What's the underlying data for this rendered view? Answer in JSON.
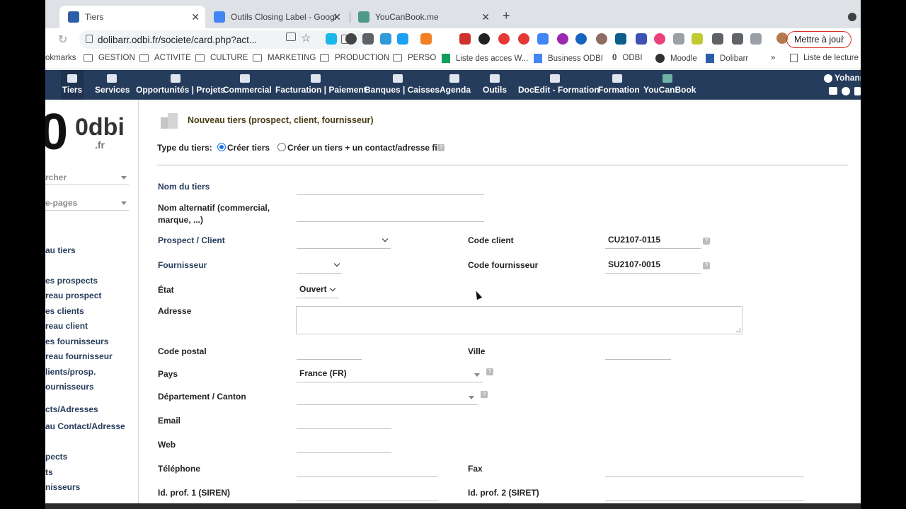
{
  "browser": {
    "tabs": [
      {
        "title": "Tiers",
        "favicon_color": "#2c5ea8"
      },
      {
        "title": "Outils Closing Label - Google D",
        "favicon_color": "#4285f4"
      },
      {
        "title": "YouCanBook.me",
        "favicon_color": "#4e9a8a"
      }
    ],
    "new_tab": "+",
    "url": "dolibarr.odbi.fr/societe/card.php?act...",
    "update_button": "Mettre à jour",
    "bookmarks": [
      {
        "label": "okmarks",
        "type": "text"
      },
      {
        "label": "GESTION",
        "type": "folder"
      },
      {
        "label": "ACTIVITE",
        "type": "folder"
      },
      {
        "label": "CULTURE",
        "type": "folder"
      },
      {
        "label": "MARKETING",
        "type": "folder"
      },
      {
        "label": "PRODUCTION",
        "type": "folder"
      },
      {
        "label": "PERSO",
        "type": "folder"
      },
      {
        "label": "Liste des acces W...",
        "type": "sheet"
      },
      {
        "label": "Business ODBI",
        "type": "doc"
      },
      {
        "label": "ODBI",
        "type": "logo"
      },
      {
        "label": "Moodle",
        "type": "logo"
      },
      {
        "label": "Dolibarr",
        "type": "logo"
      }
    ],
    "bookmarks_more": "»",
    "reading_list": "Liste de lecture"
  },
  "app": {
    "menu": [
      {
        "label": "Tiers",
        "active": true
      },
      {
        "label": "Services"
      },
      {
        "label": "Opportunités | Projets"
      },
      {
        "label": "Commercial"
      },
      {
        "label": "Facturation | Paiement"
      },
      {
        "label": "Banques | Caisses"
      },
      {
        "label": "Agenda"
      },
      {
        "label": "Outils"
      },
      {
        "label": "DocEdit - Formation"
      },
      {
        "label": "Formation"
      },
      {
        "label": "YouCanBook"
      }
    ],
    "user": "Yohann",
    "logo_text": "0dbi",
    "logo_sub": ".fr"
  },
  "sidebar": {
    "search_label": "rcher",
    "bookmarks_label": "e-pages",
    "items": [
      "au tiers",
      "es prospects",
      "reau prospect",
      "es clients",
      "reau client",
      "es fournisseurs",
      "reau fournisseur",
      "lients/prosp.",
      "ournisseurs",
      "cts/Adresses",
      "au Contact/Adresse",
      "pects",
      "ts",
      "nisseurs"
    ]
  },
  "form": {
    "title": "Nouveau tiers (prospect, client, fournisseur)",
    "type_label": "Type du tiers:",
    "type_option1": "Créer tiers",
    "type_option2": "Créer un tiers + un contact/adresse fils",
    "help_glyph": "?",
    "name_label": "Nom du tiers",
    "alt_name_label_1": "Nom alternatif (commercial,",
    "alt_name_label_2": "marque, ...)",
    "prospect_client_label": "Prospect / Client",
    "code_client_label": "Code client",
    "code_client_value": "CU2107-0115",
    "supplier_label": "Fournisseur",
    "code_supplier_label": "Code fournisseur",
    "code_supplier_value": "SU2107-0015",
    "state_label": "État",
    "state_value": "Ouvert",
    "address_label": "Adresse",
    "zip_label": "Code postal",
    "city_label": "Ville",
    "country_label": "Pays",
    "country_value": "France (FR)",
    "department_label": "Département / Canton",
    "email_label": "Email",
    "web_label": "Web",
    "phone_label": "Téléphone",
    "fax_label": "Fax",
    "prof1_label": "Id. prof. 1 (SIREN)",
    "prof2_label": "Id. prof. 2 (SIRET)"
  },
  "colors": {
    "topmenu": "#263c5c",
    "title_brown": "#4a3a14",
    "required_label": "#263c5c"
  }
}
